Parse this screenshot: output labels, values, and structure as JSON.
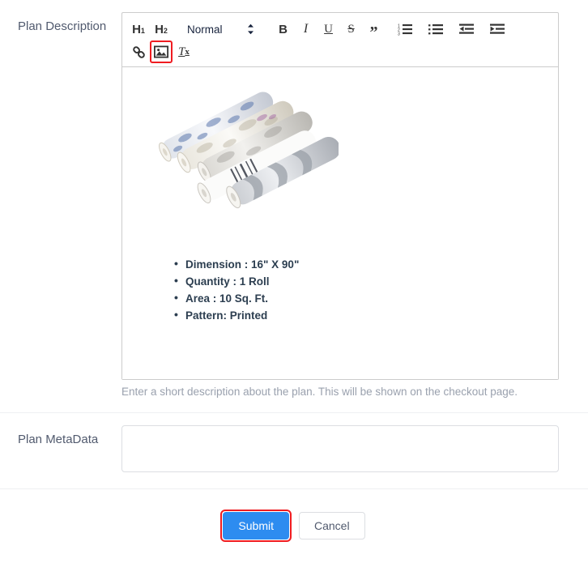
{
  "form": {
    "description_field": {
      "label": "Plan Description",
      "help_text": "Enter a short description about the plan. This will be shown on the checkout page."
    },
    "metadata_field": {
      "label": "Plan MetaData",
      "value": "",
      "placeholder": ""
    }
  },
  "editor": {
    "toolbar": {
      "h1_label": "H",
      "h1_sub": "1",
      "h2_label": "H",
      "h2_sub": "2",
      "format_select_value": "Normal",
      "bold_label": "B",
      "italic_label": "I",
      "underline_label": "U",
      "strike_label": "S",
      "quote_label": "”",
      "clear_format_label": "T",
      "clear_format_sub": "x"
    },
    "content": {
      "image_alt": "Rolls of patterned wallpaper",
      "bullets": [
        "Dimension : 16\" X 90\"",
        "Quantity : 1 Roll",
        "Area : 10 Sq. Ft.",
        "Pattern: Printed"
      ]
    }
  },
  "actions": {
    "submit_label": "Submit",
    "cancel_label": "Cancel"
  },
  "colors": {
    "primary": "#2d8cf0",
    "highlight": "#ef1c21",
    "label_text": "#515a6e",
    "help_text": "#9aa1ae",
    "editor_border": "#cccccc"
  }
}
